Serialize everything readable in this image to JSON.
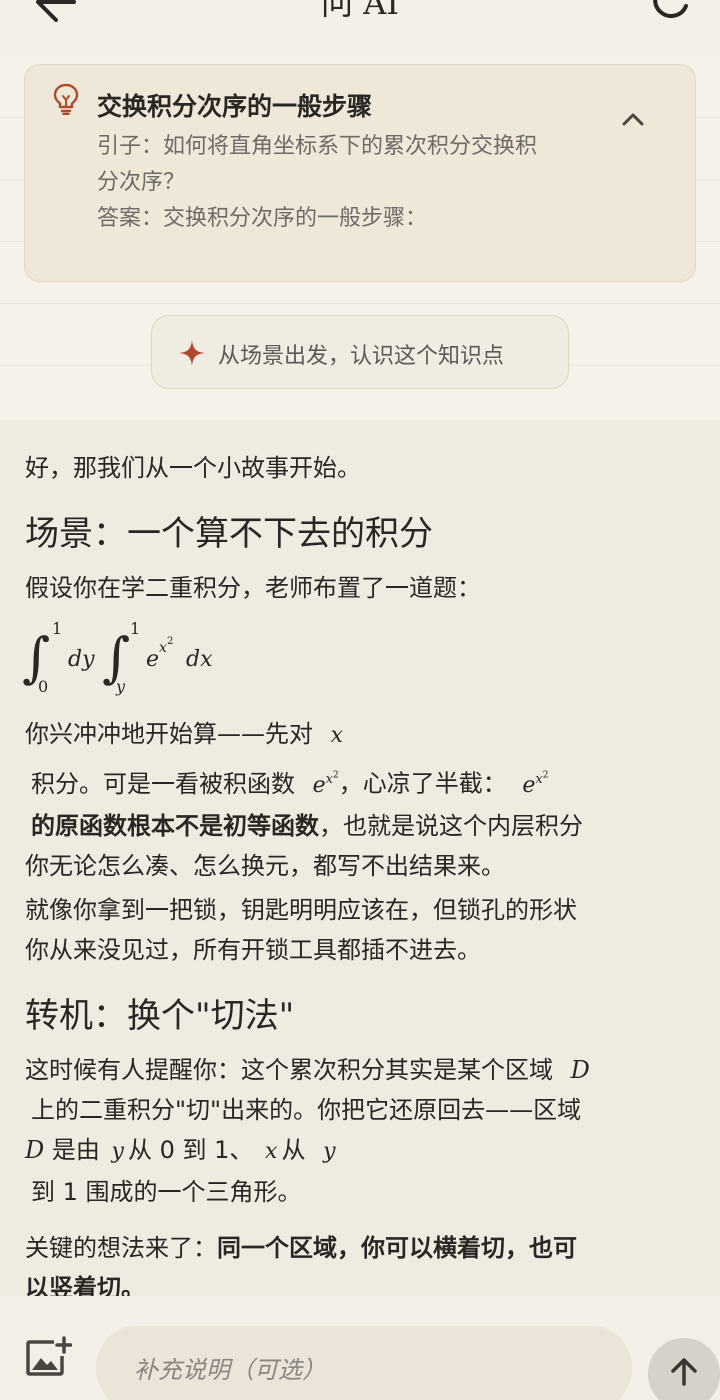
{
  "header": {
    "title": "问 AI"
  },
  "topic_card": {
    "title": "交换积分次序的一般步骤",
    "intro_line1": "引子：如何将直角坐标系下的累次积分交换积",
    "intro_line2": "分次序？",
    "answer_line": "答案：交换积分次序的一般步骤："
  },
  "scene_button": {
    "label": "从场景出发，认识这个知识点"
  },
  "answer": {
    "opening": "好，那我们从一个小故事开始。",
    "heading1": "场景：一个算不下去的积分",
    "p1": "假设你在学二重积分，老师布置了一道题：",
    "formula": {
      "outer_lower": "0",
      "outer_upper": "1",
      "outer_var": "dy",
      "inner_lower": "y",
      "inner_upper": "1",
      "integrand_base": "e",
      "integrand_exp_base": "x",
      "integrand_exp_pow": "2",
      "inner_var": "dx"
    },
    "p2": {
      "t1": "你兴冲冲地开始算——先对",
      "var_x": "x",
      "t2": "积分。可是一看被积函数",
      "e_base": "e",
      "e_exp_base": "x",
      "e_exp_pow": "2",
      "t3": "，心凉了半截：",
      "bold": "的原函数根本不是初等函数",
      "t4": "，也就是说这个内层积分",
      "t5": "你无论怎么凑、怎么换元，都写不出结果来。"
    },
    "p3_line1": "就像你拿到一把锁，钥匙明明应该在，但锁孔的形状",
    "p3_line2": "你从来没见过，所有开锁工具都插不进去。",
    "heading2": "转机：换个\"切法\"",
    "p4": {
      "t1": "这时候有人提醒你：这个累次积分其实是某个区域",
      "var_D": "D",
      "t2": "上的二重积分\"切\"出来的。你把它还原回去——区域",
      "t3": "是由",
      "var_y": "y",
      "t4": "从 0 到 1、",
      "var_x": "x",
      "t5": "从",
      "t6": "到 1 围成的一个三角形。"
    },
    "p5": {
      "t1": "关键的想法来了：",
      "bold1": "同一个区域，你可以横着切，也可",
      "bold2": "以竖着切。"
    }
  },
  "input": {
    "placeholder": "补充说明（可选）"
  },
  "colors": {
    "accent": "#b04a2f",
    "background": "#f3efe6",
    "card": "#efe7d8"
  },
  "icons": {
    "back": "arrow-left-icon",
    "refresh": "refresh-icon",
    "topic": "lightbulb-icon",
    "collapse": "chevron-up-icon",
    "scene": "sparkle-icon",
    "image": "add-image-icon",
    "send": "arrow-up-icon"
  }
}
